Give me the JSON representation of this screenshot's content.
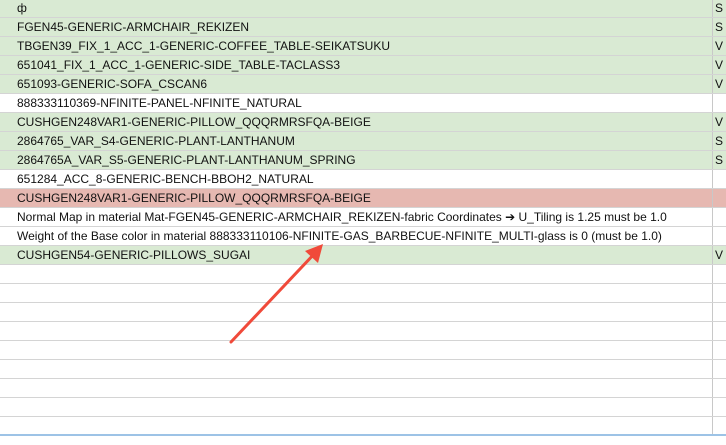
{
  "rows": [
    {
      "a": "ф",
      "b": "S",
      "color": "green"
    },
    {
      "a": "FGEN45-GENERIC-ARMCHAIR_REKIZEN",
      "b": "S",
      "color": "green"
    },
    {
      "a": "TBGEN39_FIX_1_ACC_1-GENERIC-COFFEE_TABLE-SEIKATSUKU",
      "b": "V",
      "color": "green"
    },
    {
      "a": "651041_FIX_1_ACC_1-GENERIC-SIDE_TABLE-TACLASS3",
      "b": "V",
      "color": "green"
    },
    {
      "a": "651093-GENERIC-SOFA_CSCAN6",
      "b": "V",
      "color": "green"
    },
    {
      "a": "888333110369-NFINITE-PANEL-NFINITE_NATURAL",
      "b": "",
      "color": "white"
    },
    {
      "a": "CUSHGEN248VAR1-GENERIC-PILLOW_QQQRMRSFQA-BEIGE",
      "b": "V",
      "color": "green"
    },
    {
      "a": "2864765_VAR_S4-GENERIC-PLANT-LANTHANUM",
      "b": "S",
      "color": "green"
    },
    {
      "a": "2864765A_VAR_S5-GENERIC-PLANT-LANTHANUM_SPRING",
      "b": "S",
      "color": "green"
    },
    {
      "a": "651284_ACC_8-GENERIC-BENCH-BBOH2_NATURAL",
      "b": "",
      "color": "white"
    },
    {
      "a": "CUSHGEN248VAR1-GENERIC-PILLOW_QQQRMRSFQA-BEIGE",
      "b": "",
      "color": "red"
    },
    {
      "a": "Normal Map   in material   Mat-FGEN45-GENERIC-ARMCHAIR_REKIZEN-fabric   Coordinates ➔ U_Tiling is 1.25   must be 1.0",
      "b": "",
      "color": "white"
    },
    {
      "a": "Weight of the Base color   in material   888333110106-NFINITE-GAS_BARBECUE-NFINITE_MULTI-glass   is 0   (must be 1.0)",
      "b": "",
      "color": "white"
    },
    {
      "a": "CUSHGEN54-GENERIC-PILLOWS_SUGAI",
      "b": "V",
      "color": "green"
    },
    {
      "a": "",
      "b": "",
      "color": "white"
    },
    {
      "a": "",
      "b": "",
      "color": "white"
    },
    {
      "a": "",
      "b": "",
      "color": "white"
    },
    {
      "a": "",
      "b": "",
      "color": "white"
    },
    {
      "a": "",
      "b": "",
      "color": "white"
    },
    {
      "a": "",
      "b": "",
      "color": "white"
    },
    {
      "a": "",
      "b": "",
      "color": "white"
    },
    {
      "a": "",
      "b": "",
      "color": "white"
    },
    {
      "a": "",
      "b": "",
      "color": "white"
    }
  ],
  "colors": {
    "green": "#d9ead3",
    "red": "#e6b8b1",
    "arrow": "#f04a3a",
    "selection": "#9dc3e6"
  }
}
